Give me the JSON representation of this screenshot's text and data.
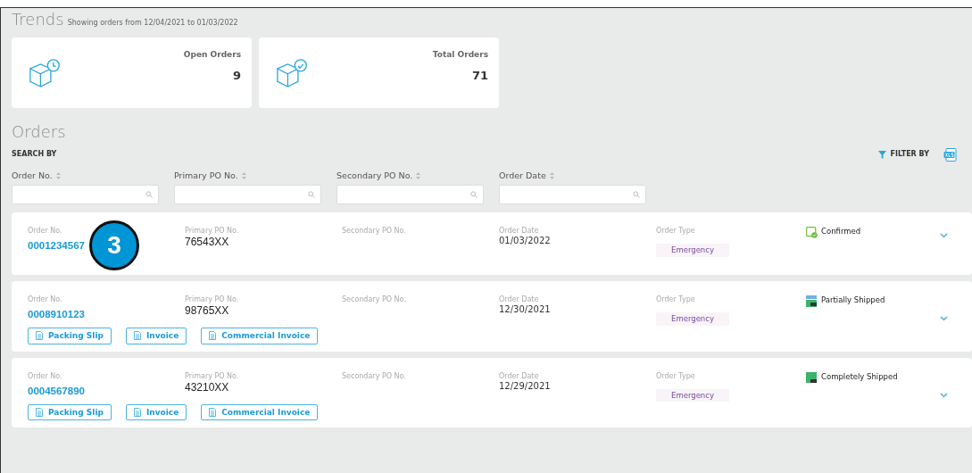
{
  "trends": {
    "title": "Trends",
    "subtitle": "Showing orders from 12/04/2021 to 01/03/2022",
    "cards": [
      {
        "kind": "open",
        "label": "Open Orders",
        "value": "9"
      },
      {
        "kind": "total",
        "label": "Total Orders",
        "value": "71"
      }
    ]
  },
  "orders_title": "Orders",
  "search_by": "SEARCH BY",
  "filter_by": "FILTER BY",
  "search_fields": [
    {
      "label": "Order No."
    },
    {
      "label": "Primary PO No."
    },
    {
      "label": "Secondary PO No."
    },
    {
      "label": "Order Date"
    }
  ],
  "orders": [
    {
      "order_no_label": "Order No.",
      "order_no": "0001234567",
      "primary_label": "Primary PO No.",
      "primary": "76543XX",
      "secondary_label": "Secondary PO No.",
      "date_label": "Order Date",
      "date": "01/03/2022",
      "type_label": "Order Type",
      "type": "Emergency",
      "kind": "confirmed",
      "status": "Confirmed",
      "callout": "3"
    },
    {
      "order_no_label": "Order No.",
      "order_no": "0008910123",
      "primary_label": "Primary PO No.",
      "primary": "98765XX",
      "secondary_label": "Secondary PO No.",
      "date_label": "Order Date",
      "date": "12/30/2021",
      "type_label": "Order Type",
      "type": "Emergency",
      "kind": "partial",
      "status": "Partially Shipped",
      "documents": [
        "Packing Slip",
        "Invoice",
        "Commercial Invoice"
      ]
    },
    {
      "order_no_label": "Order No.",
      "order_no": "0004567890",
      "primary_label": "Primary PO No.",
      "primary": "43210XX",
      "secondary_label": "Secondary PO No.",
      "date_label": "Order Date",
      "date": "12/29/2021",
      "type_label": "Order Type",
      "type": "Emergency",
      "kind": "complete",
      "status": "Completely Shipped",
      "documents": [
        "Packing Slip",
        "Invoice",
        "Commercial Invoice"
      ]
    }
  ]
}
